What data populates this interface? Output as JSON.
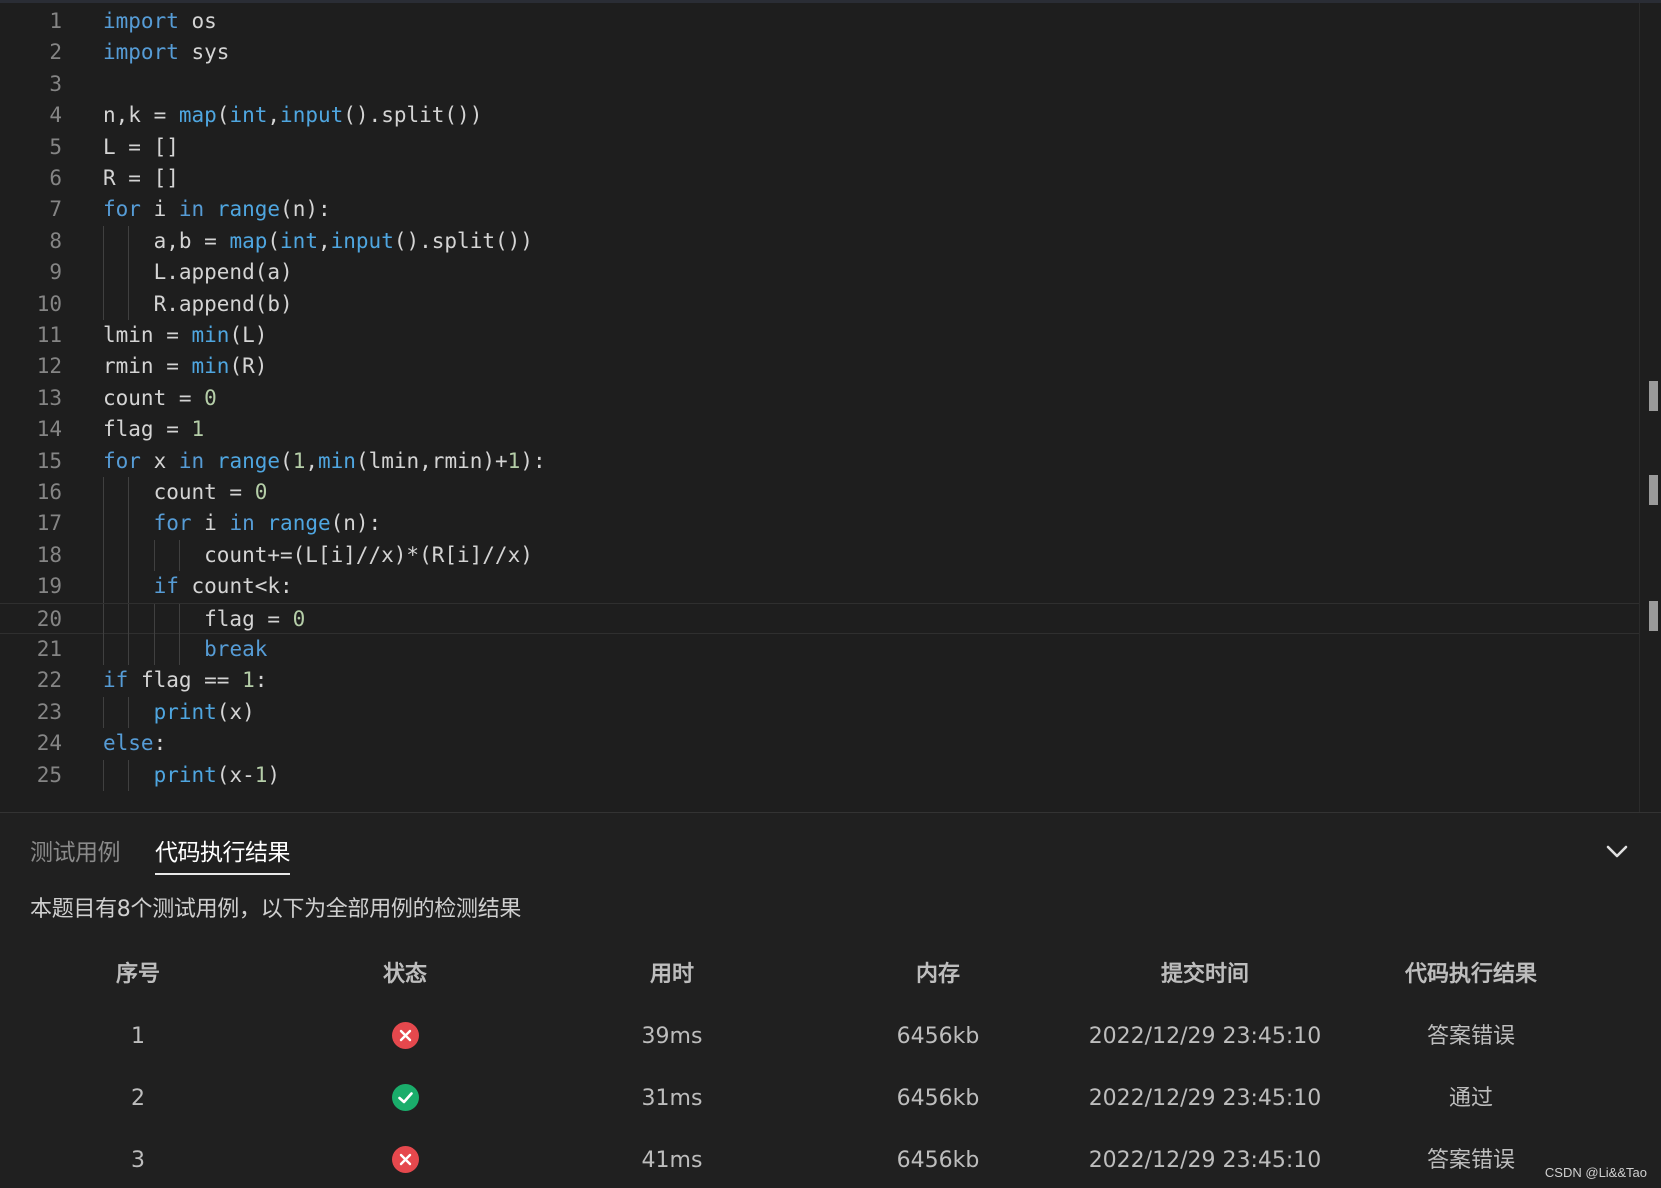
{
  "editor": {
    "line_numbers": [
      "1",
      "2",
      "3",
      "4",
      "5",
      "6",
      "7",
      "8",
      "9",
      "10",
      "11",
      "12",
      "13",
      "14",
      "15",
      "16",
      "17",
      "18",
      "19",
      "20",
      "21",
      "22",
      "23",
      "24",
      "25"
    ]
  },
  "panel": {
    "tabs": [
      {
        "label": "测试用例"
      },
      {
        "label": "代码执行结果"
      }
    ],
    "summary": "本题目有8个测试用例，以下为全部用例的检测结果",
    "headers": [
      "序号",
      "状态",
      "用时",
      "内存",
      "提交时间",
      "代码执行结果"
    ],
    "rows": [
      {
        "index": "1",
        "status": "error",
        "time": "39ms",
        "memory": "6456kb",
        "submitted": "2022/12/29 23:45:10",
        "result": "答案错误"
      },
      {
        "index": "2",
        "status": "pass",
        "time": "31ms",
        "memory": "6456kb",
        "submitted": "2022/12/29 23:45:10",
        "result": "通过"
      },
      {
        "index": "3",
        "status": "error",
        "time": "41ms",
        "memory": "6456kb",
        "submitted": "2022/12/29 23:45:10",
        "result": "答案错误"
      }
    ]
  },
  "colors": {
    "error": "#e5484d",
    "pass": "#1aad6b",
    "keyword": "#569cd6"
  },
  "watermark": "CSDN @Li&&Tao"
}
